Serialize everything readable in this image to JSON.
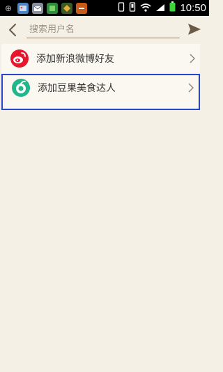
{
  "status_bar": {
    "time": "10:50",
    "battery_level": "battery-full-icon",
    "notification_icons": [
      "photo-icon",
      "mail-icon",
      "android-icon",
      "game-icon",
      "tools-icon"
    ]
  },
  "header": {
    "search_placeholder": "搜索用户名"
  },
  "list": {
    "items": [
      {
        "label": "添加新浪微博好友",
        "icon": "weibo-icon"
      },
      {
        "label": "添加豆果美食达人",
        "icon": "douguo-icon"
      }
    ]
  },
  "colors": {
    "background": "#f4f0e6",
    "row_background": "#fbf8f1",
    "weibo_red": "#e6162d",
    "douguo_green": "#22b68a",
    "selection_border": "#2b46c8",
    "header_icon": "#6b5a46"
  }
}
